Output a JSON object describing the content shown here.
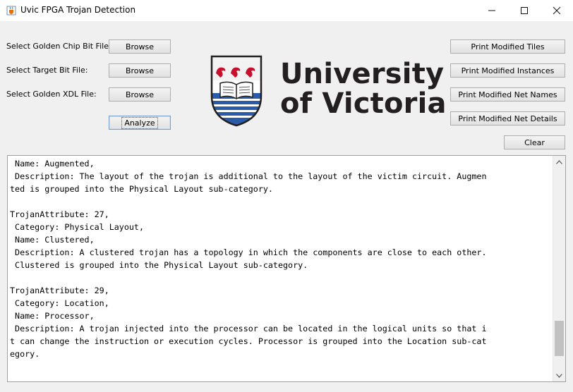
{
  "window": {
    "title": "Uvic FPGA Trojan Detection",
    "icon": "java-cup-icon"
  },
  "window_controls": {
    "minimize": "minimize-icon",
    "maximize": "maximize-icon",
    "close": "close-icon"
  },
  "left_panel": {
    "golden_chip_label": "Select Golden Chip Bit File:",
    "target_bit_label": "Select Target Bit File:",
    "golden_xdl_label": "Select Golden XDL File:",
    "browse_label": "Browse",
    "analyze_label": "Analyze"
  },
  "logo": {
    "line1": "University",
    "line2": "of Victoria"
  },
  "right_panel": {
    "print_tiles": "Print Modified Tiles",
    "print_instances": "Print Modified Instances",
    "print_net_names": "Print Modified Net Names",
    "print_net_details": "Print Modified Net Details",
    "clear": "Clear"
  },
  "output": {
    "lines": [
      " Name: Augmented,",
      " Description: The layout of the trojan is additional to the layout of the victim circuit. Augmen",
      "ted is grouped into the Physical Layout sub-category.",
      "",
      "TrojanAttribute: 27,",
      " Category: Physical Layout,",
      " Name: Clustered,",
      " Description: A clustered trojan has a topology in which the components are close to each other.",
      " Clustered is grouped into the Physical Layout sub-category.",
      "",
      "TrojanAttribute: 29,",
      " Category: Location,",
      " Name: Processor,",
      " Description: A trojan injected into the processor can be located in the logical units so that i",
      "t can change the instruction or execution cycles. Processor is grouped into the Location sub-cat",
      "egory."
    ],
    "scroll_position": 0.92
  }
}
